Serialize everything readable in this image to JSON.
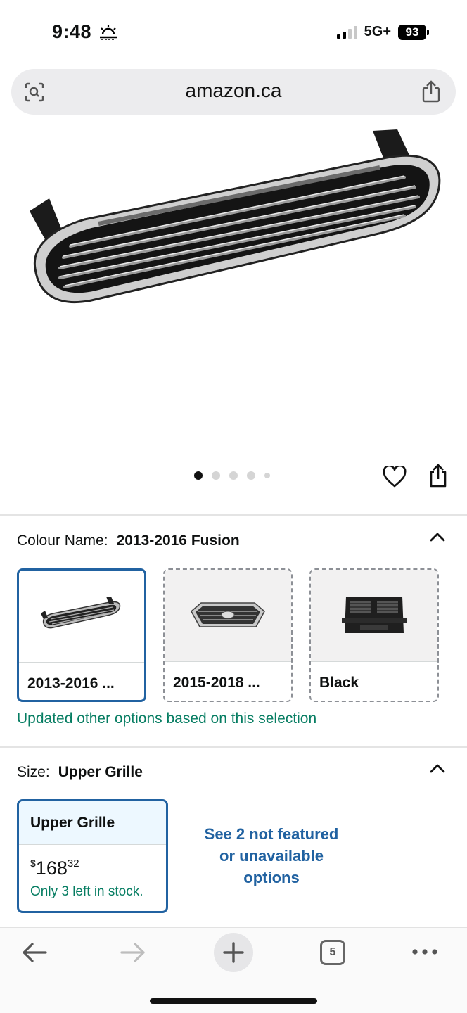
{
  "status_bar": {
    "time": "9:48",
    "network": "5G+",
    "battery": "93"
  },
  "browser": {
    "url": "amazon.ca",
    "tab_count": "5"
  },
  "product": {
    "carousel": {
      "total_images": 5,
      "active_index": 0
    }
  },
  "colour": {
    "label": "Colour Name:",
    "value": "2013-2016 Fusion",
    "options": [
      {
        "label": "2013-2016 ...",
        "selected": true
      },
      {
        "label": "2015-2018 ...",
        "selected": false
      },
      {
        "label": "Black",
        "selected": false
      }
    ],
    "note": "Updated other options based on this selection"
  },
  "size": {
    "label": "Size:",
    "value": "Upper Grille",
    "card": {
      "title": "Upper Grille",
      "currency": "$",
      "price_whole": "168",
      "price_fraction": "32",
      "stock": "Only 3 left in stock."
    },
    "see_more_line1": "See 2 not featured",
    "see_more_line2": "or unavailable",
    "see_more_line3": "options"
  },
  "colors": {
    "accent_blue": "#2162a1",
    "green": "#067d62"
  }
}
